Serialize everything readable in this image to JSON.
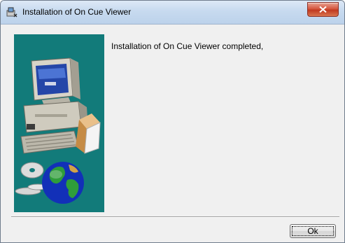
{
  "window": {
    "title": "Installation of On Cue Viewer",
    "message": "Installation of On Cue Viewer completed,"
  },
  "buttons": {
    "ok_label": "Ok"
  },
  "icons": {
    "app": "installer-icon",
    "close": "close-icon",
    "illustration": "computer-and-globe-illustration"
  },
  "colors": {
    "side_panel": "#127b7a",
    "close_button": "#c7402a"
  }
}
